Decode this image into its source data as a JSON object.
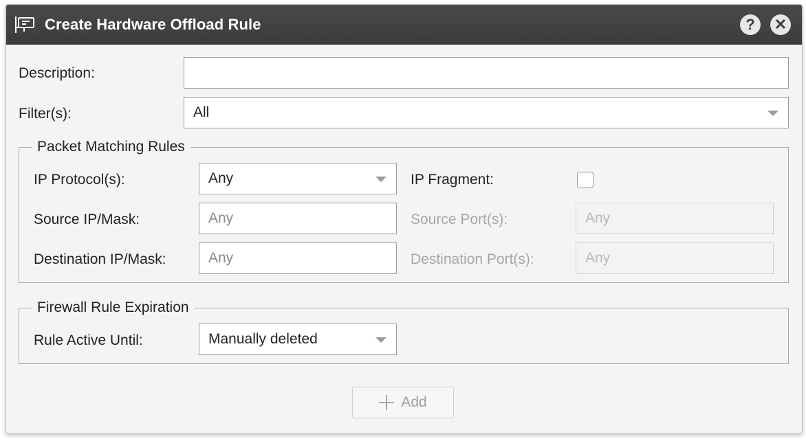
{
  "dialog": {
    "title": "Create Hardware Offload Rule",
    "help_label": "?",
    "close_label": "✕"
  },
  "form": {
    "description_label": "Description:",
    "description_value": "",
    "filters_label": "Filter(s):",
    "filters_value": "All"
  },
  "packet_matching": {
    "legend": "Packet Matching Rules",
    "ip_protocol_label": "IP Protocol(s):",
    "ip_protocol_value": "Any",
    "ip_fragment_label": "IP Fragment:",
    "ip_fragment_checked": false,
    "source_ip_label": "Source IP/Mask:",
    "source_ip_placeholder": "Any",
    "source_port_label": "Source Port(s):",
    "source_port_placeholder": "Any",
    "destination_ip_label": "Destination IP/Mask:",
    "destination_ip_placeholder": "Any",
    "destination_port_label": "Destination Port(s):",
    "destination_port_placeholder": "Any"
  },
  "expiration": {
    "legend": "Firewall Rule Expiration",
    "active_until_label": "Rule Active Until:",
    "active_until_value": "Manually deleted"
  },
  "actions": {
    "add_label": "Add"
  },
  "icons": {
    "title": "rule-card-icon",
    "help": "help-icon",
    "close": "close-icon",
    "add": "plus-icon",
    "dropdown": "chevron-down-icon"
  }
}
